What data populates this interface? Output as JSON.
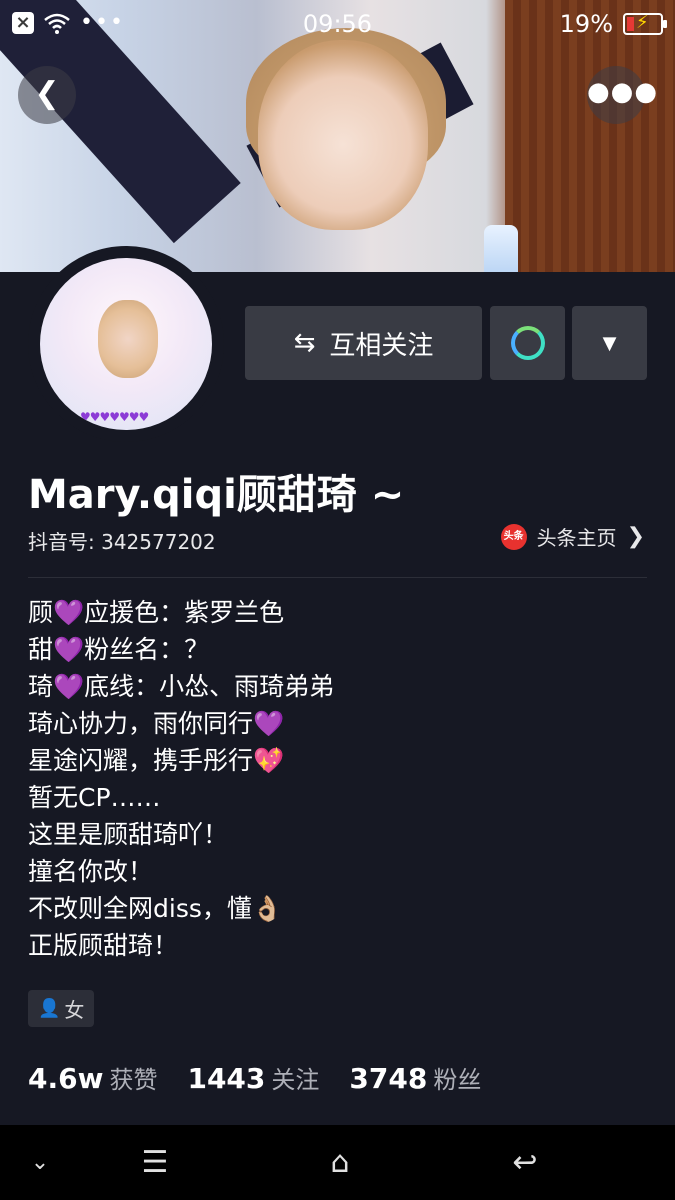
{
  "status_bar": {
    "time": "09:56",
    "battery": "19%",
    "battery_level": 0.19,
    "icons": [
      "close-box-icon",
      "wifi-icon",
      "more-dots-icon",
      "battery-charging-icon"
    ]
  },
  "header": {
    "back_icon": "chevron-left-icon",
    "more_icon": "more-horizontal-icon"
  },
  "profile": {
    "name": "Mary.qiqi顾甜琦 ~",
    "douyin_id": "抖音号: 342577202",
    "toutiao_label": "头条主页",
    "toutiao_icon_text": "头条"
  },
  "actions": {
    "mutual_follow": "互相关注",
    "swap_glyph": "⇆",
    "dropdown_glyph": "▼"
  },
  "bio": [
    "顾💜应援色：紫罗兰色",
    "甜💜粉丝名：？",
    "琦💜底线：小怂、雨琦弟弟",
    "琦心协力，雨你同行💜",
    "星途闪耀，携手彤行💖",
    "暂无CP……",
    "这里是顾甜琦吖！",
    "撞名你改！",
    "不改则全网diss，懂👌🏼",
    "正版顾甜琦！"
  ],
  "gender": "女",
  "stats": [
    {
      "num": "4.6w",
      "label": "获赞"
    },
    {
      "num": "1443",
      "label": "关注"
    },
    {
      "num": "3748",
      "label": "粉丝"
    }
  ],
  "colors": {
    "background": "#161823",
    "button": "#393b44",
    "toutiao_red": "#e8322f",
    "chat_accent": "#3fe0c5"
  }
}
